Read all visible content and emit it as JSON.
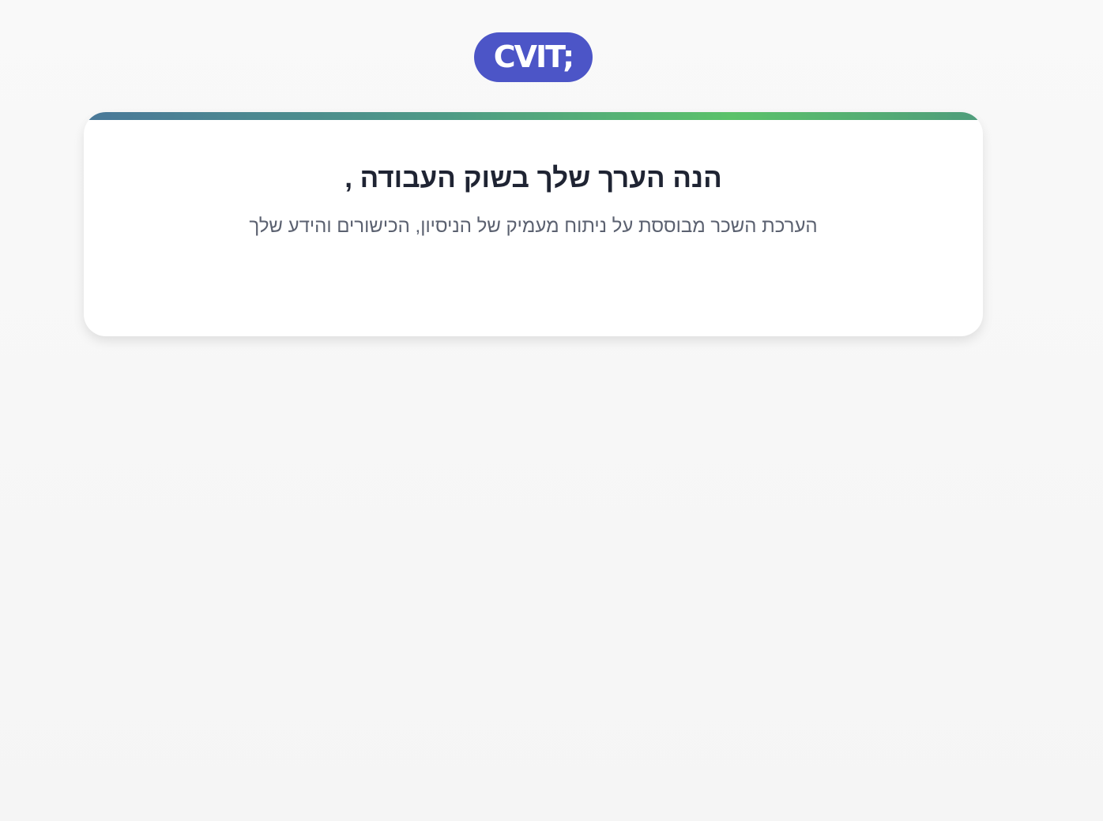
{
  "logo": {
    "text": "CVIT;"
  },
  "card": {
    "title": "הנה הערך שלך בשוק העבודה ,",
    "subtitle": "הערכת השכר מבוססת על ניתוח מעמיק של הניסיון, הכישורים והידע שלך"
  },
  "colors": {
    "logo_bg": "#4c55c7",
    "accent_gradient": [
      "#4a7899",
      "#4e9a86",
      "#5bc26a",
      "#4f9c7c"
    ],
    "title": "#1f2433",
    "subtitle": "#5b6170"
  }
}
